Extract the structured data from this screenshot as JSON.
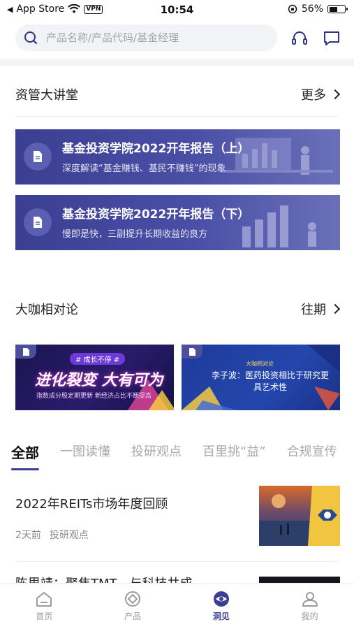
{
  "status_bar": {
    "back_app": "App Store",
    "vpn": "VPN",
    "time": "10:54",
    "battery_percent": "56%",
    "battery_level": 0.56
  },
  "search": {
    "placeholder": "产品名称/产品代码/基金经理"
  },
  "lecture_section": {
    "title": "资管大讲堂",
    "more_label": "更多",
    "banners": [
      {
        "title": "基金投资学院2022开年报告（上）",
        "subtitle": "深度解读“基金赚钱、基民不赚钱”的现象"
      },
      {
        "title": "基金投资学院2022开年报告（下）",
        "subtitle": "慢即是快，三副提升长期收益的良方"
      }
    ]
  },
  "dialogue_section": {
    "title": "大咖相对论",
    "more_label": "往期",
    "cards": [
      {
        "tag": "# 成长不停 #",
        "title": "进化裂变 大有可为",
        "subtitle": "指数成分股定期更新 新经济占比不断提高"
      },
      {
        "tag": "大咖相对论",
        "title": "李子波：医药投资相比于研究更具艺术性"
      }
    ]
  },
  "tabs": [
    "全部",
    "一图读懂",
    "投研观点",
    "百里挑“益”",
    "合规宣传"
  ],
  "articles": [
    {
      "title": "2022年REITs市场年度回顾",
      "time": "2天前",
      "category": "投研观点"
    },
    {
      "title": "陈思靖：聚焦TMT，与科技共成"
    }
  ],
  "bottom_nav": [
    {
      "label": "首页",
      "icon": "home-icon"
    },
    {
      "label": "产品",
      "icon": "product-icon"
    },
    {
      "label": "洞见",
      "icon": "eye-icon"
    },
    {
      "label": "我的",
      "icon": "user-icon"
    }
  ],
  "colors": {
    "accent": "#3b3f92",
    "banner": "#4a4fa6",
    "inactive_text": "#a8a8b0"
  }
}
